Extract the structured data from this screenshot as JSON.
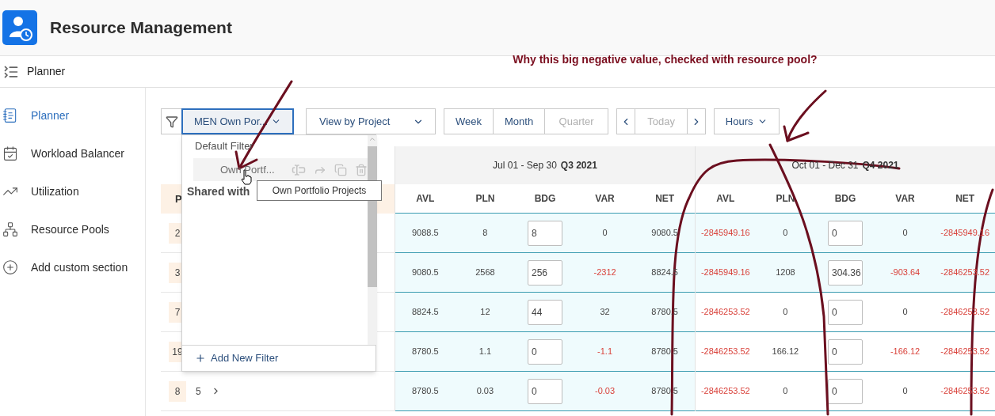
{
  "app": {
    "title": "Resource Management"
  },
  "breadcrumb": {
    "label": "Planner"
  },
  "sidebar": {
    "items": [
      {
        "label": "Planner",
        "selected": true
      },
      {
        "label": "Workload Balancer",
        "selected": false
      },
      {
        "label": "Utilization",
        "selected": false
      },
      {
        "label": "Resource Pools",
        "selected": false
      },
      {
        "label": "Add custom section",
        "selected": false
      }
    ]
  },
  "annotation": {
    "text": "Why this big negative value, checked with resource pool?"
  },
  "toolbar": {
    "filter_dropdown": {
      "label": "MEN Own Por...",
      "open": true
    },
    "view_dropdown": {
      "label": "View by Project"
    },
    "periods": [
      {
        "label": "Week",
        "selected": false
      },
      {
        "label": "Month",
        "selected": false
      },
      {
        "label": "Quarter",
        "selected": true
      }
    ],
    "today": {
      "label": "Today",
      "disabled": true
    },
    "units": {
      "label": "Hours"
    }
  },
  "filter_menu": {
    "section": "Default Filter",
    "items": [
      {
        "label": "Own Portf...",
        "hovered": true
      }
    ],
    "shared_heading": "Shared with",
    "tooltip": "Own Portfolio Projects",
    "add_label": "Add New Filter"
  },
  "table": {
    "project_header": "P",
    "quarters": [
      {
        "range": "Jul 01 - Sep 30",
        "label": "Q3 2021",
        "columns": [
          {
            "label": "AVL",
            "kind": "text"
          },
          {
            "label": "PLN",
            "kind": "text"
          },
          {
            "label": "BDG",
            "kind": "input"
          },
          {
            "label": "VAR",
            "kind": "text"
          },
          {
            "label": "NET",
            "kind": "text"
          }
        ]
      },
      {
        "range": "Oct 01 - Dec 31",
        "label": "Q4 2021",
        "columns": [
          {
            "label": "AVL",
            "kind": "text"
          },
          {
            "label": "PLN",
            "kind": "text"
          },
          {
            "label": "BDG",
            "kind": "input"
          },
          {
            "label": "VAR",
            "kind": "text"
          },
          {
            "label": "NET",
            "kind": "text"
          }
        ]
      }
    ],
    "rows": [
      {
        "badge": "2",
        "quarters": [
          {
            "highlighted": true,
            "cells": [
              {
                "text": "9088.5",
                "negative": false
              },
              {
                "text": "8",
                "negative": false
              },
              {
                "text": "8",
                "negative": false
              },
              {
                "text": "0",
                "negative": false
              },
              {
                "text": "9080.5",
                "negative": false
              }
            ]
          },
          {
            "highlighted": true,
            "cells": [
              {
                "text": "-2845949.16",
                "negative": true
              },
              {
                "text": "0",
                "negative": false
              },
              {
                "text": "0",
                "negative": false
              },
              {
                "text": "0",
                "negative": false
              },
              {
                "text": "-2845949.16",
                "negative": true
              }
            ]
          }
        ]
      },
      {
        "badge": "3",
        "quarters": [
          {
            "highlighted": true,
            "cells": [
              {
                "text": "9080.5",
                "negative": false
              },
              {
                "text": "2568",
                "negative": false
              },
              {
                "text": "256",
                "negative": false
              },
              {
                "text": "-2312",
                "negative": true
              },
              {
                "text": "8824.5",
                "negative": false
              }
            ]
          },
          {
            "highlighted": true,
            "cells": [
              {
                "text": "-2845949.16",
                "negative": true
              },
              {
                "text": "1208",
                "negative": false
              },
              {
                "text": "304.36",
                "negative": false
              },
              {
                "text": "-903.64",
                "negative": true
              },
              {
                "text": "-2846253.52",
                "negative": true
              }
            ]
          }
        ]
      },
      {
        "badge": "7",
        "quarters": [
          {
            "highlighted": true,
            "cells": [
              {
                "text": "8824.5",
                "negative": false
              },
              {
                "text": "12",
                "negative": false
              },
              {
                "text": "44",
                "negative": false
              },
              {
                "text": "32",
                "negative": false
              },
              {
                "text": "8780.5",
                "negative": false
              }
            ]
          },
          {
            "highlighted": false,
            "cells": [
              {
                "text": "-2846253.52",
                "negative": true
              },
              {
                "text": "0",
                "negative": false
              },
              {
                "text": "0",
                "negative": false
              },
              {
                "text": "0",
                "negative": false
              },
              {
                "text": "-2846253.52",
                "negative": true
              }
            ]
          }
        ]
      },
      {
        "badge": "19",
        "quarters": [
          {
            "highlighted": true,
            "cells": [
              {
                "text": "8780.5",
                "negative": false
              },
              {
                "text": "1.1",
                "negative": false
              },
              {
                "text": "0",
                "negative": false
              },
              {
                "text": "-1.1",
                "negative": true
              },
              {
                "text": "8780.5",
                "negative": false
              }
            ]
          },
          {
            "highlighted": false,
            "cells": [
              {
                "text": "-2846253.52",
                "negative": true
              },
              {
                "text": "166.12",
                "negative": false
              },
              {
                "text": "0",
                "negative": false
              },
              {
                "text": "-166.12",
                "negative": true
              },
              {
                "text": "-2846253.52",
                "negative": true
              }
            ]
          }
        ]
      },
      {
        "badge": "8",
        "count": "5",
        "quarters": [
          {
            "highlighted": true,
            "cells": [
              {
                "text": "8780.5",
                "negative": false
              },
              {
                "text": "0.03",
                "negative": false
              },
              {
                "text": "0",
                "negative": false
              },
              {
                "text": "-0.03",
                "negative": true
              },
              {
                "text": "8780.5",
                "negative": false
              }
            ]
          },
          {
            "highlighted": false,
            "cells": [
              {
                "text": "-2846253.52",
                "negative": true
              },
              {
                "text": "0",
                "negative": false
              },
              {
                "text": "0",
                "negative": false
              },
              {
                "text": "0",
                "negative": false
              },
              {
                "text": "-2846253.52",
                "negative": true
              }
            ]
          }
        ]
      }
    ]
  }
}
